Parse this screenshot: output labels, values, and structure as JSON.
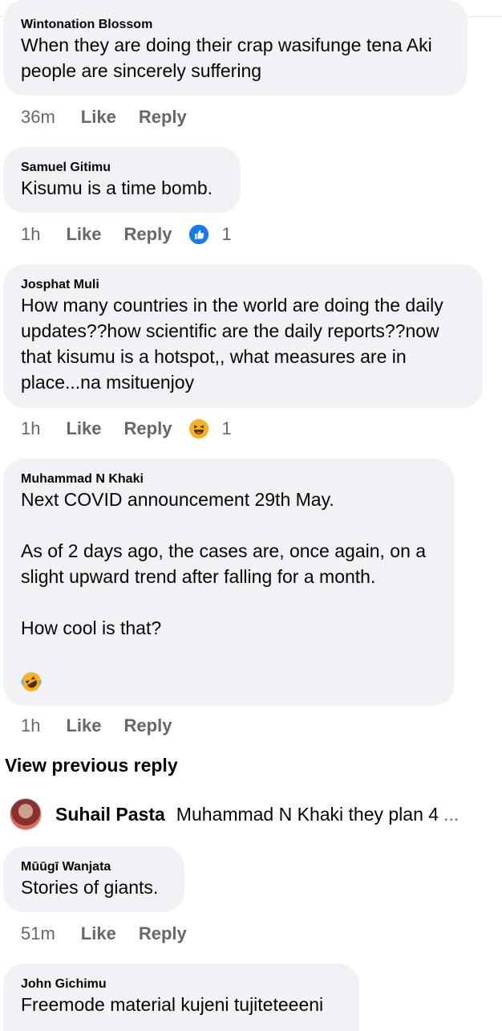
{
  "comments": [
    {
      "author": "Wintonation Blossom",
      "text": "When they are doing their crap wasifunge tena Aki people are sincerely suffering",
      "time": "36m",
      "like": "Like",
      "reply": "Reply"
    },
    {
      "author": "Samuel Gitimu",
      "text": "Kisumu is a time bomb.",
      "time": "1h",
      "like": "Like",
      "reply": "Reply",
      "reaction": {
        "icon": "like-reaction-icon",
        "count": "1",
        "color": "#1877f2"
      }
    },
    {
      "author": "Josphat Muli",
      "text": "How many countries in the world are doing the daily updates??how scientific are the daily reports??now that kisumu is a hotspot,, what measures are in place...na msituenjoy",
      "time": "1h",
      "like": "Like",
      "reply": "Reply",
      "reaction": {
        "icon": "haha-reaction-icon",
        "count": "1",
        "color": "#f7b125"
      }
    },
    {
      "author": "Muhammad N Khaki",
      "text": "Next COVID announcement 29th May.\n\nAs of 2 days ago, the cases are, once again, on a slight upward trend after falling for a month.\n\nHow cool is that?",
      "emoji": "rofl-emoji-icon",
      "time": "1h",
      "like": "Like",
      "reply": "Reply"
    },
    {
      "author": "Mūūgī Wanjata",
      "text": "Stories of giants.",
      "time": "51m",
      "like": "Like",
      "reply": "Reply"
    },
    {
      "author": "John Gichimu",
      "text": "Freemode material kujeni tujiteteeeni"
    }
  ],
  "view_previous": "View previous reply",
  "reply_preview": {
    "author": "Suhail Pasta",
    "text": "Muhammad N Khaki they plan 4",
    "ellipsis": "..."
  }
}
